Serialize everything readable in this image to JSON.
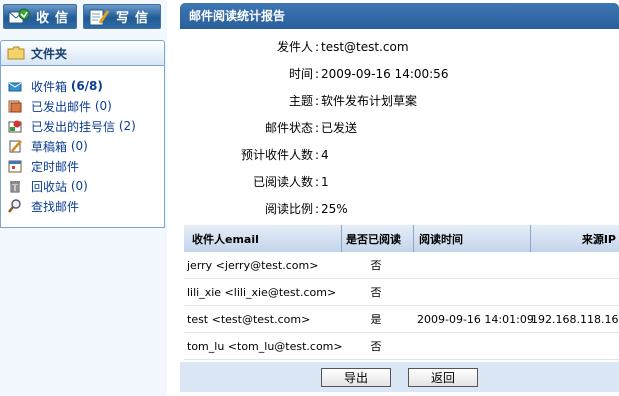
{
  "toolbar": {
    "receive_label": "收信",
    "write_label": "写信"
  },
  "sidebar": {
    "header": "文件夹",
    "items": [
      {
        "label": "收件箱",
        "count": "(6/8)",
        "icon": "inbox-icon"
      },
      {
        "label": "已发出邮件",
        "count": "(0)",
        "icon": "sent-mail-icon"
      },
      {
        "label": "已发出的挂号信",
        "count": "(2)",
        "icon": "registered-mail-icon"
      },
      {
        "label": "草稿箱",
        "count": "(0)",
        "icon": "drafts-icon"
      },
      {
        "label": "定时邮件",
        "count": "",
        "icon": "scheduled-mail-icon"
      },
      {
        "label": "回收站",
        "count": "(0)",
        "icon": "trash-icon"
      },
      {
        "label": "查找邮件",
        "count": "",
        "icon": "search-mail-icon"
      }
    ]
  },
  "report": {
    "title": "邮件阅读统计报告",
    "fields": [
      {
        "key": "发件人",
        "value": "test@test.com"
      },
      {
        "key": "时间",
        "value": "2009-09-16 14:00:56"
      },
      {
        "key": "主题",
        "value": "软件发布计划草案"
      },
      {
        "key": "邮件状态",
        "value": "已发送"
      },
      {
        "key": "预计收件人数",
        "value": "4"
      },
      {
        "key": "已阅读人数",
        "value": "1"
      },
      {
        "key": "阅读比例",
        "value": "25%"
      }
    ],
    "table": {
      "headers": [
        "收件人email",
        "是否已阅读",
        "阅读时间",
        "来源IP"
      ],
      "rows": [
        [
          "jerry <jerry@test.com>",
          "否",
          "",
          ""
        ],
        [
          "lili_xie <lili_xie@test.com>",
          "否",
          "",
          ""
        ],
        [
          "test <test@test.com>",
          "是",
          "2009-09-16 14:01:09",
          "192.168.118.16"
        ],
        [
          "tom_lu <tom_lu@test.com>",
          "否",
          "",
          ""
        ]
      ]
    },
    "buttons": {
      "export_label": "导出",
      "back_label": "返回"
    }
  },
  "colors": {
    "title_bar": "#2d65a0",
    "link": "#0b3d91",
    "footer": "#dbe7f4"
  }
}
